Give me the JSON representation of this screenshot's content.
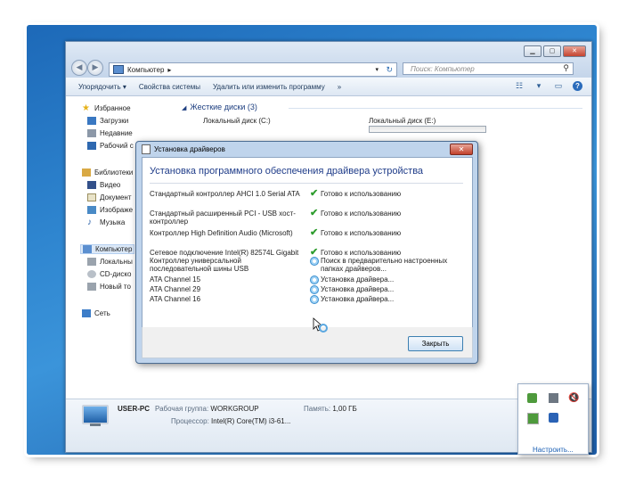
{
  "explorer": {
    "address_crumb": "Компьютер",
    "search_placeholder": "Поиск: Компьютер",
    "toolbar": {
      "organize": "Упорядочить ▾",
      "system_props": "Свойства системы",
      "uninstall": "Удалить или изменить программу",
      "more": "»"
    },
    "sidebar": {
      "favorites": "Избранное",
      "downloads": "Загрузки",
      "recent": "Недавние",
      "desktop": "Рабочий с",
      "libraries": "Библиотеки",
      "video": "Видео",
      "documents": "Документ",
      "images": "Изображе",
      "music": "Музыка",
      "computer": "Компьютер",
      "local_disk": "Локальны",
      "cd": "CD-диско",
      "new_volume": "Новый то",
      "network": "Сеть"
    },
    "group_header": "Жесткие диски (3)",
    "disk_c": "Локальный диск (C:)",
    "disk_e": "Локальный диск (E:)",
    "details": {
      "pc_name": "USER-PC",
      "workgroup_key": "Рабочая группа:",
      "workgroup_val": "WORKGROUP",
      "memory_key": "Память:",
      "memory_val": "1,00 ГБ",
      "cpu_key": "Процессор:",
      "cpu_val": "Intel(R) Core(TM) i3-61..."
    }
  },
  "dialog": {
    "title": "Установка драйверов",
    "heading": "Установка программного обеспечения драйвера устройства",
    "close_label": "Закрыть",
    "devices": [
      {
        "name": "Стандартный контроллер AHCI 1.0 Serial ATA",
        "status": "Готово к использованию",
        "state": "done"
      },
      {
        "name": "Стандартный расширенный PCI - USB хост-контроллер",
        "status": "Готово к использованию",
        "state": "done"
      },
      {
        "name": "Контроллер High Definition Audio (Microsoft)",
        "status": "Готово к использованию",
        "state": "done"
      },
      {
        "name": "Сетевое подключение Intel(R) 82574L Gigabit",
        "status": "Готово к использованию",
        "state": "done"
      },
      {
        "name": "Контроллер универсальной последовательной шины USB",
        "status": "Поиск в предварительно настроенных папках драйверов...",
        "state": "pending"
      },
      {
        "name": "ATA Channel 15",
        "status": "Установка драйвера...",
        "state": "pending"
      },
      {
        "name": "ATA Channel 29",
        "status": "Установка драйвера...",
        "state": "pending"
      },
      {
        "name": "ATA Channel 16",
        "status": "Установка драйвера...",
        "state": "pending"
      }
    ]
  },
  "tray": {
    "customize_link": "Настроить..."
  },
  "colors": {
    "accent": "#1f3c89",
    "check": "#2f9d2f",
    "close_red": "#c2412c"
  }
}
